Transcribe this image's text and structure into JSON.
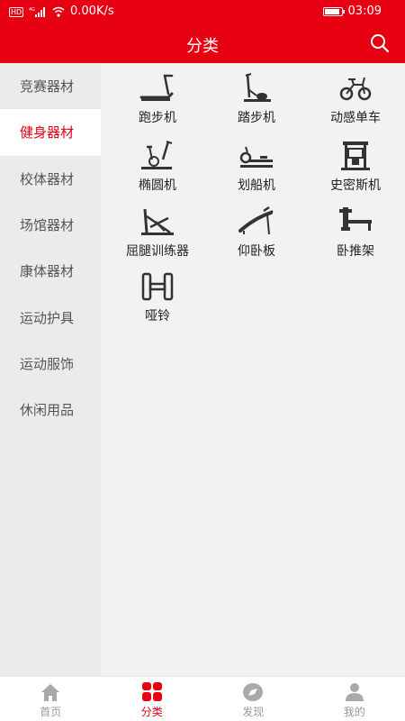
{
  "status_bar": {
    "hd_badge": "HD",
    "network": "4G",
    "speed": "0.00K/s",
    "time": "03:09"
  },
  "header": {
    "title": "分类"
  },
  "sidebar": {
    "items": [
      {
        "label": "竞赛器材",
        "active": false
      },
      {
        "label": "健身器材",
        "active": true
      },
      {
        "label": "校体器材",
        "active": false
      },
      {
        "label": "场馆器材",
        "active": false
      },
      {
        "label": "康体器材",
        "active": false
      },
      {
        "label": "运动护具",
        "active": false
      },
      {
        "label": "运动服饰",
        "active": false
      },
      {
        "label": "休闲用品",
        "active": false
      }
    ]
  },
  "categories": [
    {
      "label": "跑步机",
      "icon": "treadmill-icon"
    },
    {
      "label": "踏步机",
      "icon": "stepper-icon"
    },
    {
      "label": "动感单车",
      "icon": "spin-bike-icon"
    },
    {
      "label": "椭圆机",
      "icon": "elliptical-icon"
    },
    {
      "label": "划船机",
      "icon": "rowing-machine-icon"
    },
    {
      "label": "史密斯机",
      "icon": "smith-machine-icon"
    },
    {
      "label": "屈腿训练器",
      "icon": "leg-curl-icon"
    },
    {
      "label": "仰卧板",
      "icon": "sit-up-board-icon"
    },
    {
      "label": "卧推架",
      "icon": "bench-press-icon"
    },
    {
      "label": "哑铃",
      "icon": "dumbbell-icon"
    }
  ],
  "tabbar": {
    "items": [
      {
        "label": "首页",
        "icon": "home-icon",
        "active": false
      },
      {
        "label": "分类",
        "icon": "category-icon",
        "active": true
      },
      {
        "label": "发现",
        "icon": "compass-icon",
        "active": false
      },
      {
        "label": "我的",
        "icon": "user-icon",
        "active": false
      }
    ]
  },
  "colors": {
    "brand": "#e60012",
    "sidebar_bg": "#ebebeb",
    "content_bg": "#f2f2f2",
    "tab_inactive": "#999999"
  }
}
